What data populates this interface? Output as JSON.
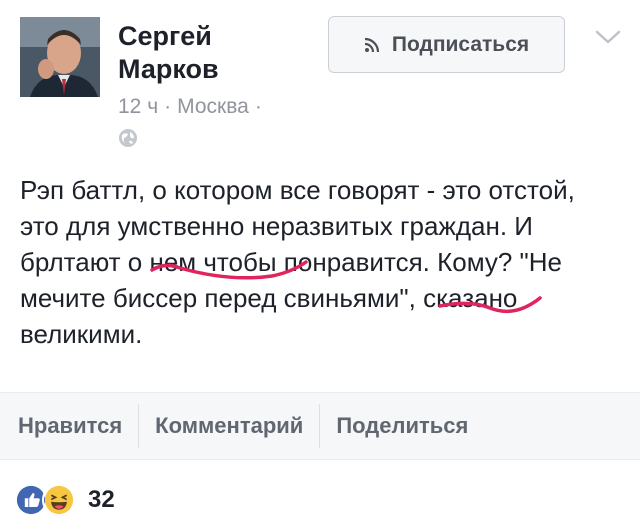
{
  "header": {
    "author_name": "Сергей Марков",
    "time": "12 ч",
    "separator": "·",
    "location": "Москва",
    "trailing_separator": "·",
    "subscribe_label": "Подписаться"
  },
  "post": {
    "text": "Рэп баттл, о котором все говорят - это отстой, это для умственно неразвитых граждан. И брлтают о нем чтобы понравится. Кому? \"Не мечите биссер перед свиньями\", сказано великими."
  },
  "actions": {
    "like_label": "Нравится",
    "comment_label": "Комментарий",
    "share_label": "Поделиться"
  },
  "reactions": {
    "count": "32",
    "icons": [
      "like-icon",
      "haha-icon"
    ]
  },
  "colors": {
    "underline_markup": "#e0245e",
    "like_blue": "#4267b2",
    "haha_yellow": "#f7c744",
    "text_primary": "#1d2129",
    "text_secondary": "#90949c"
  }
}
